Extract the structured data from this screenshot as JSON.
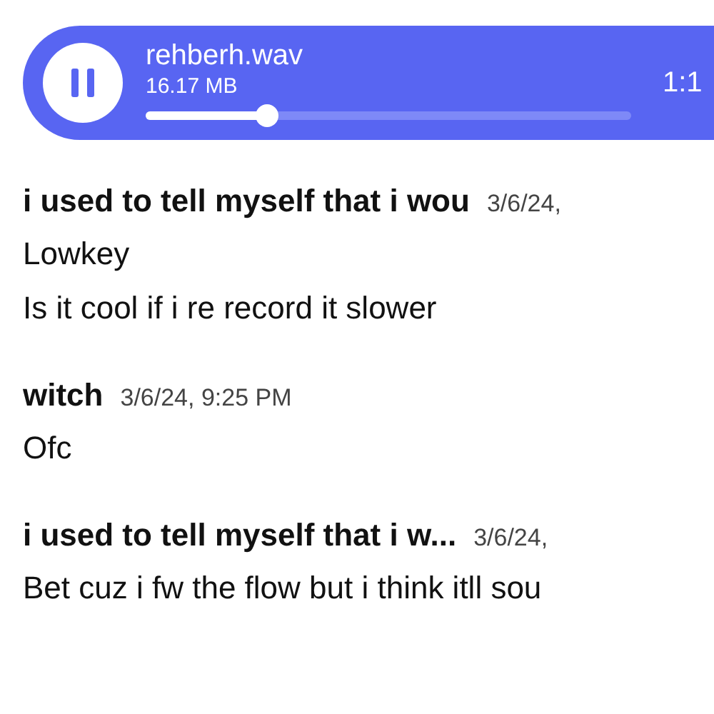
{
  "player": {
    "playing": true,
    "filename": "rehberh.wav",
    "size": "16.17 MB",
    "level": 0.25,
    "time": "1:1"
  },
  "messages": [
    {
      "author": "i used to tell myself that i wou",
      "timestamp": "3/6/24,",
      "lines": [
        "Lowkey",
        "Is it cool if i re record it slower"
      ]
    },
    {
      "author": "witch",
      "timestamp": "3/6/24, 9:25 PM",
      "lines": [
        "Ofc"
      ]
    },
    {
      "author": "i used to tell myself that i w...",
      "timestamp": "3/6/24,",
      "lines": [
        "Bet cuz i fw the flow but i think itll sou"
      ]
    }
  ]
}
